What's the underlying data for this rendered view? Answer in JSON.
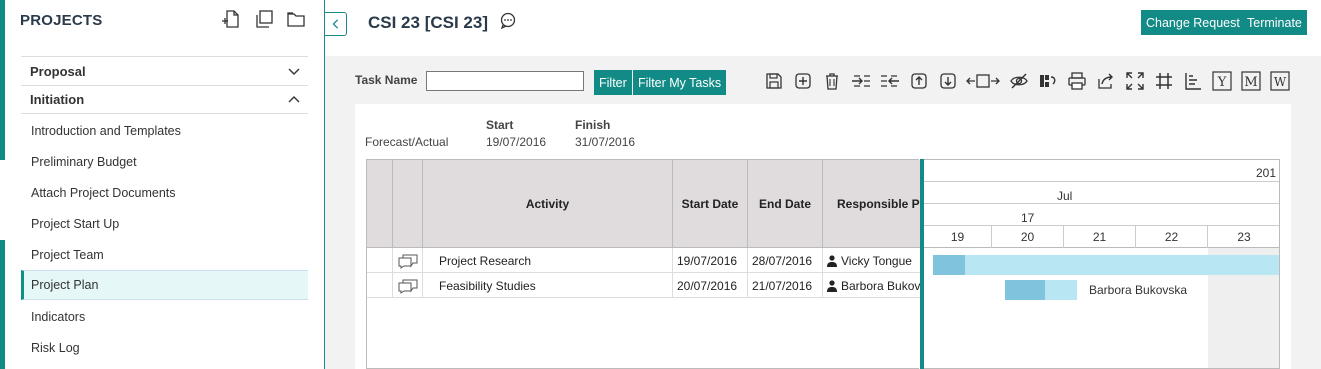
{
  "sidebar": {
    "title": "PROJECTS",
    "sections": [
      {
        "label": "Proposal",
        "expanded": false
      },
      {
        "label": "Initiation",
        "expanded": true
      }
    ],
    "items": [
      {
        "label": "Introduction and Templates"
      },
      {
        "label": "Preliminary Budget"
      },
      {
        "label": "Attach Project Documents"
      },
      {
        "label": "Project Start Up"
      },
      {
        "label": "Project Team"
      },
      {
        "label": "Project Plan",
        "active": true
      },
      {
        "label": "Indicators"
      },
      {
        "label": "Risk Log"
      }
    ]
  },
  "header": {
    "title": "CSI 23 [CSI 23]",
    "change_request": "Change Request",
    "terminate": "Terminate"
  },
  "toolbar": {
    "task_name_label": "Task Name",
    "task_name_value": "",
    "filter": "Filter",
    "filter_my_tasks": "Filter My Tasks"
  },
  "summary": {
    "start_label": "Start",
    "finish_label": "Finish",
    "row_label": "Forecast/Actual",
    "start": "19/07/2016",
    "finish": "31/07/2016"
  },
  "grid": {
    "columns": [
      "Activity",
      "Start Date",
      "End Date",
      "Responsible P"
    ],
    "rows": [
      {
        "activity": "Project Research",
        "start": "19/07/2016",
        "end": "28/07/2016",
        "responsible": "Vicky Tongue"
      },
      {
        "activity": "Feasibility Studies",
        "start": "20/07/2016",
        "end": "21/07/2016",
        "responsible": "Barbora Bukov"
      }
    ]
  },
  "gantt": {
    "year": "201",
    "month": "Jul",
    "week": "17",
    "days": [
      "19",
      "20",
      "21",
      "22",
      "23"
    ],
    "bar_label": "Barbora Bukovska"
  },
  "colors": {
    "accent": "#128b87",
    "bar_progress": "#7fc4dc",
    "bar_remaining": "#b9e6f3"
  }
}
